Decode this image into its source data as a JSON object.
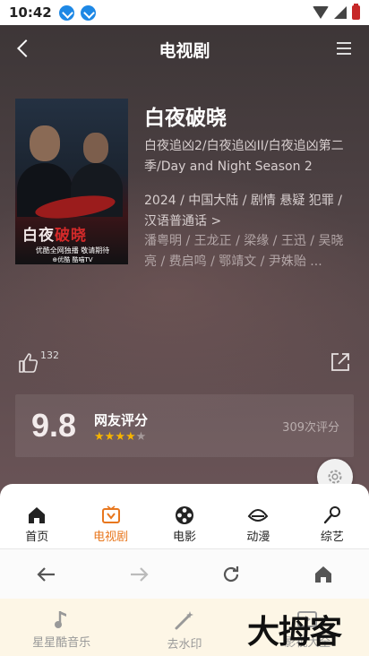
{
  "status_bar": {
    "time": "10:42"
  },
  "header": {
    "title": "电视剧"
  },
  "show": {
    "title": "白夜破晓",
    "aliases": "白夜追凶2/白夜追凶II/白夜追凶第二季/Day and Night Season 2",
    "meta": "2024 / 中国大陆 /  剧情 悬疑 犯罪 / 汉语普通话 >",
    "cast": "潘粤明 / 王龙正 / 梁缘 / 王迅 / 吴晓亮 / 费启鸣 / 鄂靖文 / 尹姝贻 ..."
  },
  "poster": {
    "title_a": "白夜",
    "title_b": "破晓",
    "tag": "优酷全网独播 敬请期待",
    "platform": "⊕优酷  酷喵TV"
  },
  "actions": {
    "like_count": "132"
  },
  "rating": {
    "score": "9.8",
    "label": "网友评分",
    "stars_filled": 4,
    "stars_total": 5,
    "count": "309次评分"
  },
  "tabs": [
    {
      "label": "首页",
      "icon": "home-icon",
      "active": false
    },
    {
      "label": "电视剧",
      "icon": "tv-icon",
      "active": true
    },
    {
      "label": "电影",
      "icon": "film-reel-icon",
      "active": false
    },
    {
      "label": "动漫",
      "icon": "anime-icon",
      "active": false
    },
    {
      "label": "综艺",
      "icon": "microphone-icon",
      "active": false
    }
  ],
  "browser_nav": [
    "back-arrow-icon",
    "forward-arrow-icon",
    "refresh-icon",
    "home-icon"
  ],
  "shortcuts": [
    {
      "label": "星星酷音乐",
      "icon": "music-note-icon"
    },
    {
      "label": "去水印",
      "icon": "magic-wand-icon"
    },
    {
      "label": "影视大全",
      "icon": "video-icon"
    }
  ],
  "watermark": "大拇客",
  "colors": {
    "accent": "#e8771e",
    "star": "#f6b400",
    "hero_bg": "#4a3f41"
  }
}
